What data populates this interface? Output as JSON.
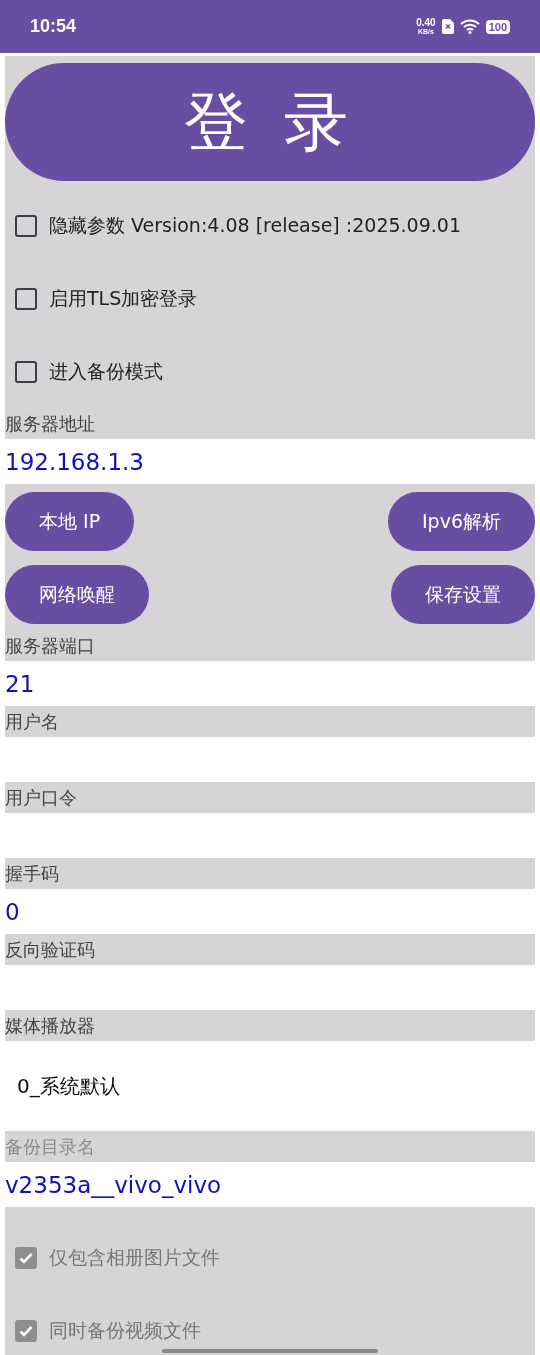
{
  "status_bar": {
    "time": "10:54",
    "speed_value": "0.40",
    "speed_unit": "KB/s",
    "battery": "100"
  },
  "login_button": "登 录",
  "options": [
    {
      "label": "隐藏参数 Version:4.08 [release] :2025.09.01",
      "checked": false
    },
    {
      "label": "启用TLS加密登录",
      "checked": false
    },
    {
      "label": "进入备份模式",
      "checked": false
    }
  ],
  "server_address": {
    "label": "服务器地址",
    "value": "192.168.1.3",
    "disabled": false
  },
  "buttons": [
    [
      "本地 IP",
      "Ipv6解析"
    ],
    [
      "网络唤醒",
      "保存设置"
    ]
  ],
  "fields": [
    {
      "kind": "input",
      "label": "服务器端口",
      "value": "21",
      "disabled": false
    },
    {
      "kind": "input",
      "label": "用户名",
      "disabled": false
    },
    {
      "kind": "input",
      "label": "用户口令",
      "disabled": false
    },
    {
      "kind": "input",
      "label": "握手码",
      "value": "0",
      "disabled": false
    },
    {
      "kind": "input",
      "label": "反向验证码",
      "disabled": false
    },
    {
      "kind": "select",
      "label": "媒体播放器",
      "value": "0_系统默认",
      "disabled": false
    },
    {
      "kind": "input",
      "label": "备份目录名",
      "value": "v2353a__vivo_vivo",
      "disabled": true
    }
  ],
  "backup_options": [
    {
      "label": "仅包含相册图片文件",
      "checked": true,
      "disabled": true
    },
    {
      "label": "同时备份视频文件",
      "checked": true,
      "disabled": true
    }
  ]
}
